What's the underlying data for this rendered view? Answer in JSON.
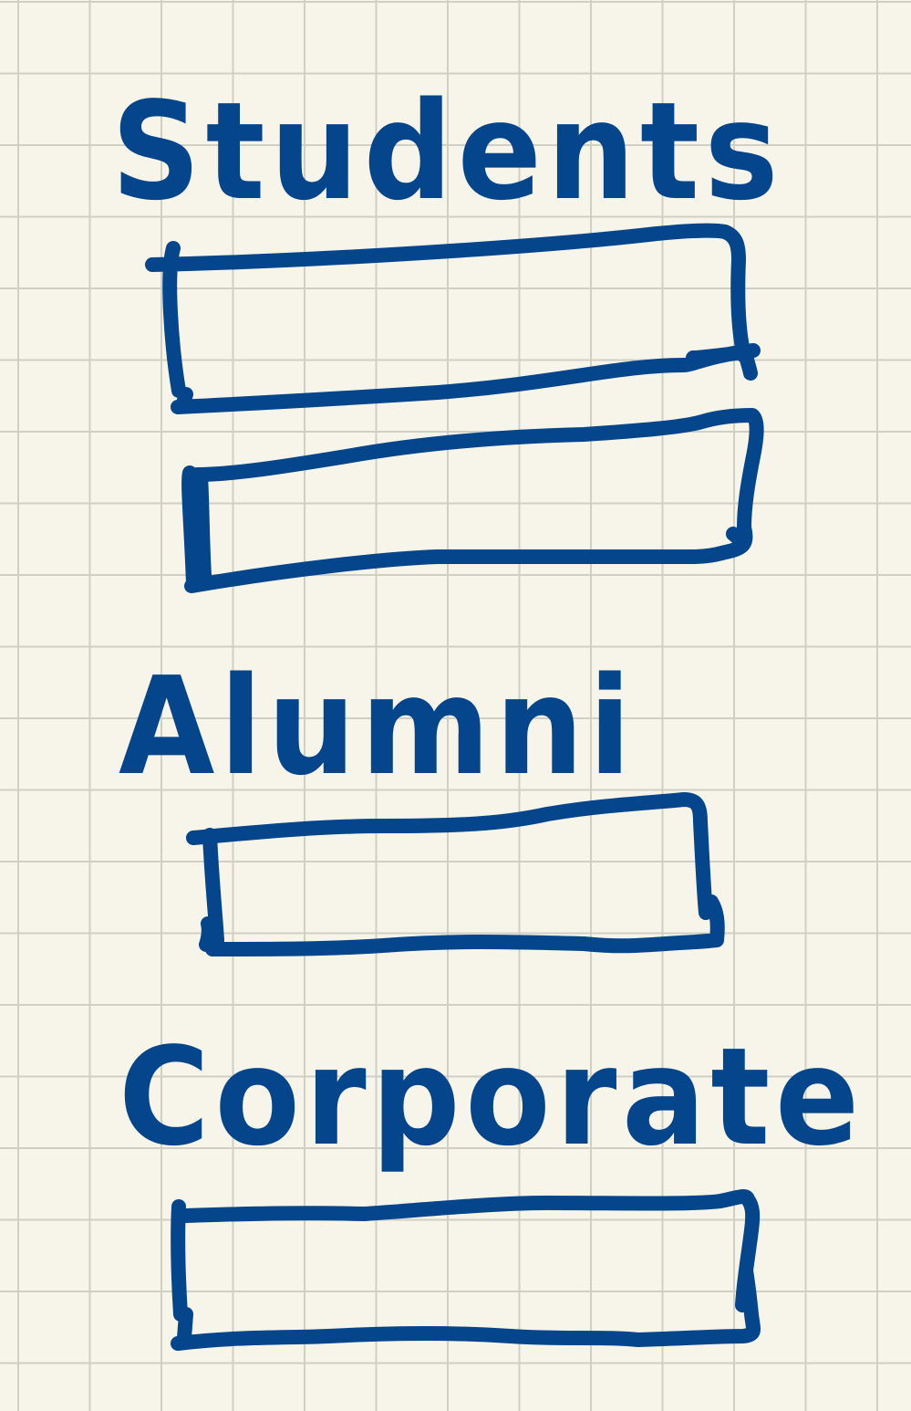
{
  "sections": {
    "students": {
      "heading": "Students"
    },
    "alumni": {
      "heading": "Alumni"
    },
    "corporate": {
      "heading": "Corporate"
    }
  },
  "colors": {
    "ink": "#05458c",
    "paper": "#f7f5e9",
    "grid": "#cfcfc4"
  }
}
